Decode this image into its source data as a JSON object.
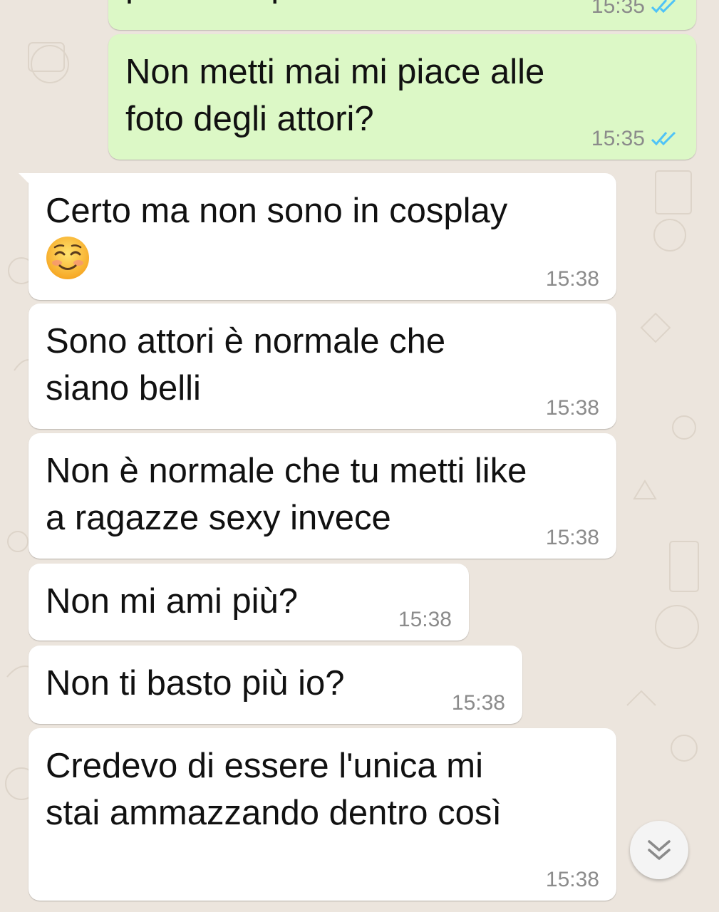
{
  "messages": [
    {
      "id": "m0",
      "direction": "outgoing",
      "text": "per esempio",
      "time": "15:35",
      "status": "read"
    },
    {
      "id": "m1",
      "direction": "outgoing",
      "text": "Non metti mai mi piace alle\nfoto degli attori?",
      "time": "15:35",
      "status": "read"
    },
    {
      "id": "m2",
      "direction": "incoming",
      "text": "Certo ma non sono in cosplay",
      "emoji": "smiling-face-emoji",
      "time": "15:38"
    },
    {
      "id": "m3",
      "direction": "incoming",
      "text": "Sono attori è normale che\nsiano belli",
      "time": "15:38"
    },
    {
      "id": "m4",
      "direction": "incoming",
      "text": "Non è normale che tu metti like\na ragazze sexy invece",
      "time": "15:38"
    },
    {
      "id": "m5",
      "direction": "incoming",
      "text": "Non mi ami più?",
      "time": "15:38"
    },
    {
      "id": "m6",
      "direction": "incoming",
      "text": "Non ti basto più io?",
      "time": "15:38"
    },
    {
      "id": "m7",
      "direction": "incoming",
      "text": "Credevo di essere l'unica mi\nstai ammazzando dentro così",
      "time": "15:38"
    }
  ],
  "colors": {
    "outgoing_bubble": "#dcf8c6",
    "incoming_bubble": "#ffffff",
    "read_ticks": "#4fc3f7",
    "timestamp": "#8b8b8b",
    "wallpaper": "#ece5dd"
  },
  "scroll_button": {
    "icon": "double-chevron-down-icon"
  }
}
